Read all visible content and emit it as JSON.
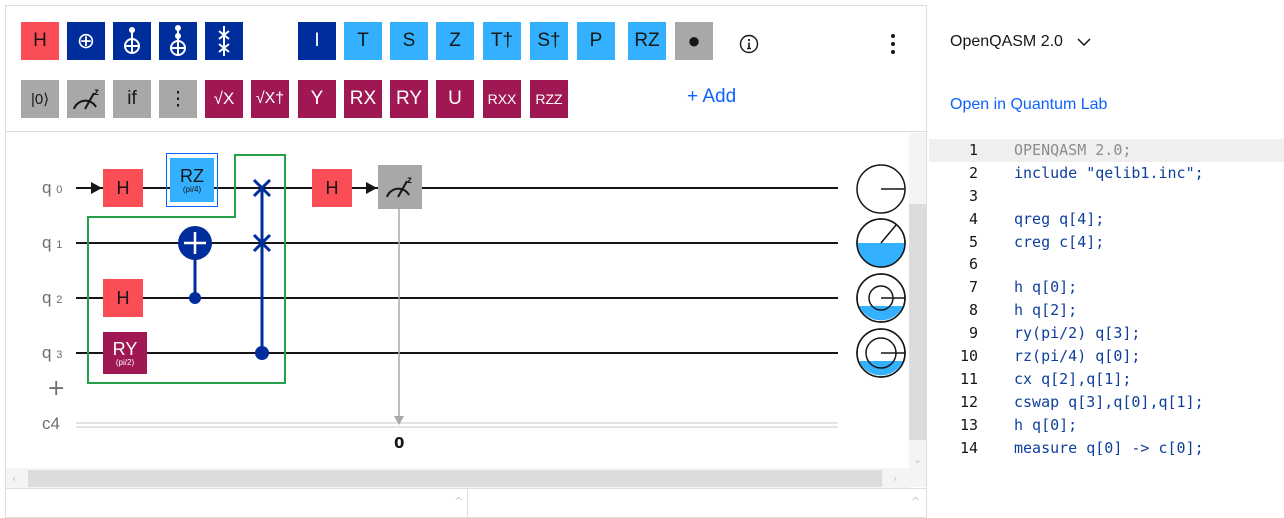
{
  "palette": {
    "row1": [
      "H",
      "⊕",
      "",
      "",
      "",
      "I",
      "T",
      "S",
      "Z",
      "T†",
      "S†",
      "P",
      "RZ",
      "●"
    ],
    "row2": [
      "|0⟩",
      "",
      "if",
      "⋮",
      "√X",
      "√X†",
      "Y",
      "RX",
      "RY",
      "U",
      "RXX",
      "RZZ"
    ],
    "add_label": "+ Add",
    "info_icon": "info-icon",
    "more_icon": "overflow-menu-icon"
  },
  "circuit": {
    "qubits": [
      {
        "name": "q",
        "index": "0"
      },
      {
        "name": "q",
        "index": "1"
      },
      {
        "name": "q",
        "index": "2"
      },
      {
        "name": "q",
        "index": "3"
      }
    ],
    "classical": "c4",
    "add_qubit": "+",
    "gates": {
      "h_q0": "H",
      "rz_q0": {
        "label": "RZ",
        "param": "(pi/4)"
      },
      "h_q2": "H",
      "ry_q3": {
        "label": "RY",
        "param": "(pi/2)"
      },
      "h_q0_second": "H"
    },
    "measure_target": "0",
    "colors": {
      "h": "#fa4d56",
      "rz": "#33b1ff",
      "ry": "#9f1853",
      "controlled": "#002d9c",
      "measure": "#a8a8a8",
      "selection": "#24a148",
      "qsphere_fill": "#33b1ff"
    }
  },
  "code_panel": {
    "language": "OpenQASM 2.0",
    "open_link": "Open in Quantum Lab",
    "lines": [
      {
        "n": "1",
        "text": "OPENQASM 2.0;"
      },
      {
        "n": "2",
        "text": "include \"qelib1.inc\";"
      },
      {
        "n": "3",
        "text": ""
      },
      {
        "n": "4",
        "text": "qreg q[4];"
      },
      {
        "n": "5",
        "text": "creg c[4];"
      },
      {
        "n": "6",
        "text": ""
      },
      {
        "n": "7",
        "text": "h q[0];"
      },
      {
        "n": "8",
        "text": "h q[2];"
      },
      {
        "n": "9",
        "text": "ry(pi/2) q[3];"
      },
      {
        "n": "10",
        "text": "rz(pi/4) q[0];"
      },
      {
        "n": "11",
        "text": "cx q[2],q[1];"
      },
      {
        "n": "12",
        "text": "cswap q[3],q[0],q[1];"
      },
      {
        "n": "13",
        "text": "h q[0];"
      },
      {
        "n": "14",
        "text": "measure q[0] -> c[0];"
      }
    ]
  }
}
